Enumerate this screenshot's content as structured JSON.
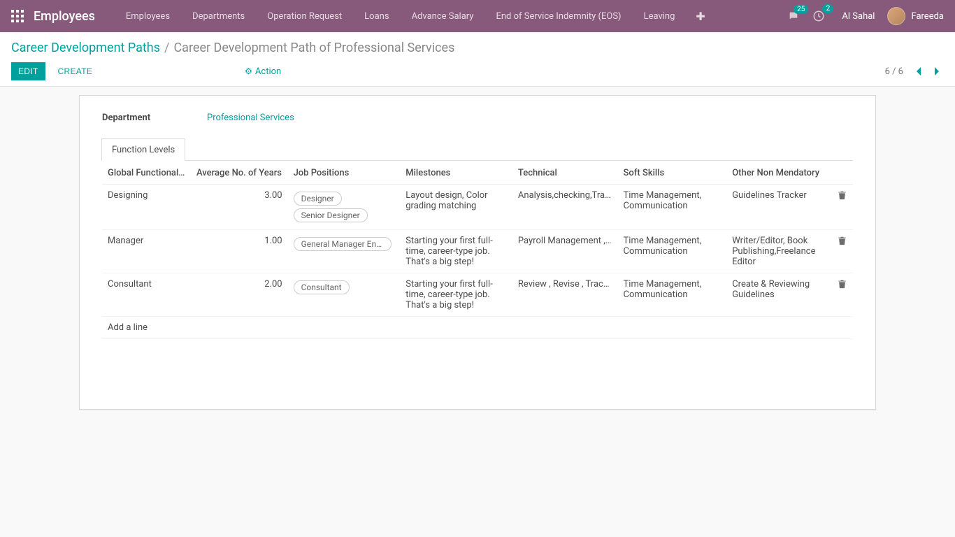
{
  "header": {
    "app_title": "Employees",
    "nav": [
      "Employees",
      "Departments",
      "Operation Request",
      "Loans",
      "Advance Salary",
      "End of Service Indemnity (EOS)",
      "Leaving"
    ],
    "messages_badge": "25",
    "activities_badge": "2",
    "company": "Al Sahal",
    "user": "Fareeda"
  },
  "breadcrumb": {
    "root": "Career Development Paths",
    "current": "Career Development Path of Professional Services"
  },
  "controls": {
    "edit": "EDIT",
    "create": "CREATE",
    "action": "Action",
    "pager": "6 / 6"
  },
  "form": {
    "department_label": "Department",
    "department_value": "Professional Services",
    "tab_label": "Function Levels"
  },
  "table": {
    "headers": {
      "level": "Global Functional…",
      "years": "Average No. of Years",
      "positions": "Job Positions",
      "milestones": "Milestones",
      "technical": "Technical",
      "soft": "Soft Skills",
      "other": "Other Non Mendatory"
    },
    "rows": [
      {
        "level": "Designing",
        "years": "3.00",
        "positions": [
          "Designer",
          "Senior Designer"
        ],
        "milestones": "Layout design, Color grading matching",
        "technical": "Analysis,checking,Tracki…",
        "soft": "Time Management, Communication",
        "other": "Guidelines Tracker"
      },
      {
        "level": "Manager",
        "years": "1.00",
        "positions": [
          "General Manager Engin…"
        ],
        "milestones": "Starting your first full-time, career-type job. That's a big step!",
        "technical": "Payroll Management , C…",
        "soft": "Time Management, Communication",
        "other": "Writer/Editor, Book Publishing,Freelance Editor"
      },
      {
        "level": "Consultant",
        "years": "2.00",
        "positions": [
          "Consultant"
        ],
        "milestones": "Starting your first full-time, career-type job. That's a big step!",
        "technical": "Review , Revise , Tracking",
        "soft": "Time Management, Communication",
        "other": "Create & Reviewing Guidelines"
      }
    ],
    "add_line": "Add a line"
  }
}
